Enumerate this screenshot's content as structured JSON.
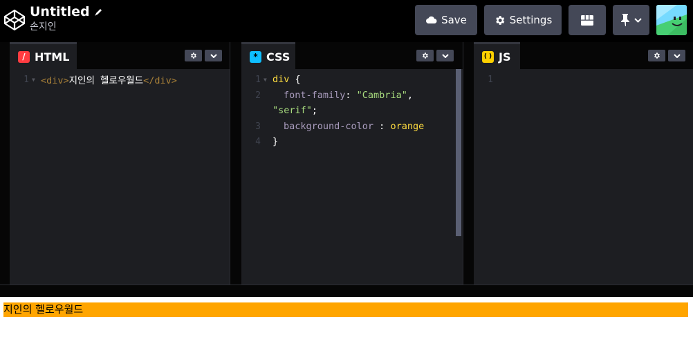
{
  "header": {
    "title": "Untitled",
    "user": "손지인",
    "save_label": "Save",
    "settings_label": "Settings",
    "icons": {
      "logo": "codepen-logo-icon",
      "edit": "pencil-icon",
      "save": "cloud-icon",
      "settings": "gear-icon",
      "layout": "layout-grid-icon",
      "pin": "pin-icon",
      "avatar": "smiley-avatar-icon"
    }
  },
  "editors": [
    {
      "lang": "HTML",
      "icon_char": "/",
      "icon_color": "#ff3c41",
      "lines": [
        {
          "n": "1",
          "fold": true
        }
      ]
    },
    {
      "lang": "CSS",
      "icon_char": "*",
      "icon_color": "#0ebeff",
      "lines": [
        {
          "n": "1",
          "fold": true
        },
        {
          "n": "2"
        },
        {
          "n": ""
        },
        {
          "n": "3"
        },
        {
          "n": "4"
        }
      ]
    },
    {
      "lang": "JS",
      "icon_char": "( )",
      "icon_color": "#fcd000",
      "lines": [
        {
          "n": "1"
        }
      ]
    }
  ],
  "code": {
    "html_open_tag": "<div>",
    "html_text": "지인의 헬로우월드",
    "html_close_tag": "</div>",
    "css_selector": "div",
    "css_open_brace": " {",
    "css_prop1": "font-family",
    "css_colon1": ": ",
    "css_str1": "\"Cambria\"",
    "css_comma": ",",
    "css_str2": "\"serif\"",
    "css_semi": ";",
    "css_prop2": "background-color",
    "css_colon2": " : ",
    "css_val2": "orange",
    "css_close_brace": "}"
  },
  "preview": {
    "text": "지인의 헬로우월드",
    "background": "#ffa500"
  },
  "colors": {
    "button_bg": "#444857",
    "editor_bg": "#1d1e22"
  }
}
